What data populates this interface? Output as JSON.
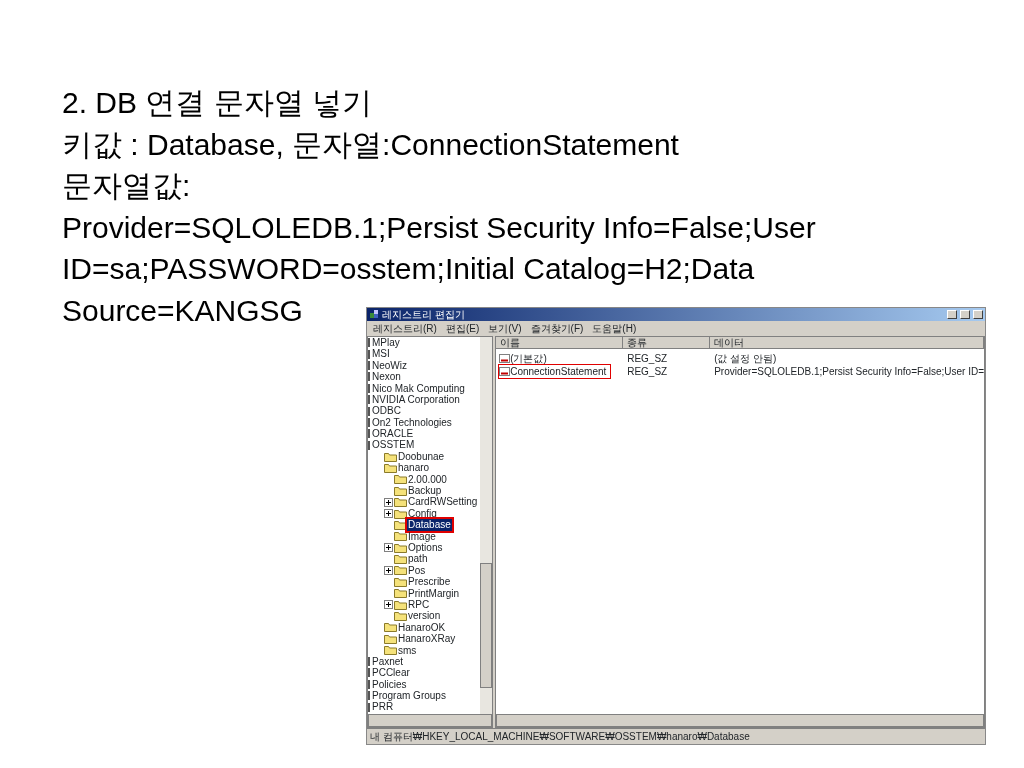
{
  "slide": {
    "lines": [
      "2. DB 연결 문자열 넣기",
      "키값 : Database, 문자열:ConnectionStatement",
      "문자열값:",
      "Provider=SQLOLEDB.1;Persist Security Info=False;User",
      "ID=sa;PASSWORD=osstem;Initial Catalog=H2;Data",
      "Source=KANGSG"
    ]
  },
  "window": {
    "title": "레지스트리 편집기",
    "menu": [
      "레지스트리(R)",
      "편집(E)",
      "보기(V)",
      "즐겨찾기(F)",
      "도움말(H)"
    ],
    "tree": [
      {
        "label": "MPlay"
      },
      {
        "label": "MSI"
      },
      {
        "label": "NeoWiz"
      },
      {
        "label": "Nexon"
      },
      {
        "label": "Nico Mak Computing"
      },
      {
        "label": "NVIDIA Corporation"
      },
      {
        "label": "ODBC"
      },
      {
        "label": "On2 Technologies"
      },
      {
        "label": "ORACLE"
      },
      {
        "label": "OSSTEM",
        "children": [
          {
            "label": "Doobunae"
          },
          {
            "label": "hanaro",
            "children": [
              {
                "label": "2.00.000",
                "expandable": false,
                "selected": false,
                "highlighted": false
              },
              {
                "label": "Backup",
                "expandable": false,
                "selected": false,
                "highlighted": false
              },
              {
                "label": "CardRWSetting",
                "expandable": true,
                "selected": false,
                "highlighted": false
              },
              {
                "label": "Config",
                "expandable": true,
                "selected": false,
                "highlighted": false
              },
              {
                "label": "Database",
                "expandable": false,
                "selected": true,
                "highlighted": true
              },
              {
                "label": "Image",
                "expandable": false,
                "selected": false,
                "highlighted": false
              },
              {
                "label": "Options",
                "expandable": true,
                "selected": false,
                "highlighted": false
              },
              {
                "label": "path",
                "expandable": false,
                "selected": false,
                "highlighted": false
              },
              {
                "label": "Pos",
                "expandable": true,
                "selected": false,
                "highlighted": false
              },
              {
                "label": "Prescribe",
                "expandable": false,
                "selected": false,
                "highlighted": false
              },
              {
                "label": "PrintMargin",
                "expandable": false,
                "selected": false,
                "highlighted": false
              },
              {
                "label": "RPC",
                "expandable": true,
                "selected": false,
                "highlighted": false
              },
              {
                "label": "version",
                "expandable": false,
                "selected": false,
                "highlighted": false
              }
            ]
          },
          {
            "label": "HanaroOK"
          },
          {
            "label": "HanaroXRay"
          },
          {
            "label": "sms"
          }
        ]
      },
      {
        "label": "Paxnet"
      },
      {
        "label": "PCClear"
      },
      {
        "label": "Policies"
      },
      {
        "label": "Program Groups"
      },
      {
        "label": "PRR"
      }
    ],
    "columns": [
      "이름",
      "종류",
      "데이터"
    ],
    "values": [
      {
        "name": "(기본값)",
        "type": "REG_SZ",
        "data": "(값 설정 안됨)",
        "highlighted": false
      },
      {
        "name": "ConnectionStatement",
        "type": "REG_SZ",
        "data": "Provider=SQLOLEDB.1;Persist Security Info=False;User ID=",
        "highlighted": true
      }
    ],
    "status_bar": "내 컴퓨터₩HKEY_LOCAL_MACHINE₩SOFTWARE₩OSSTEM₩hanaro₩Database"
  }
}
